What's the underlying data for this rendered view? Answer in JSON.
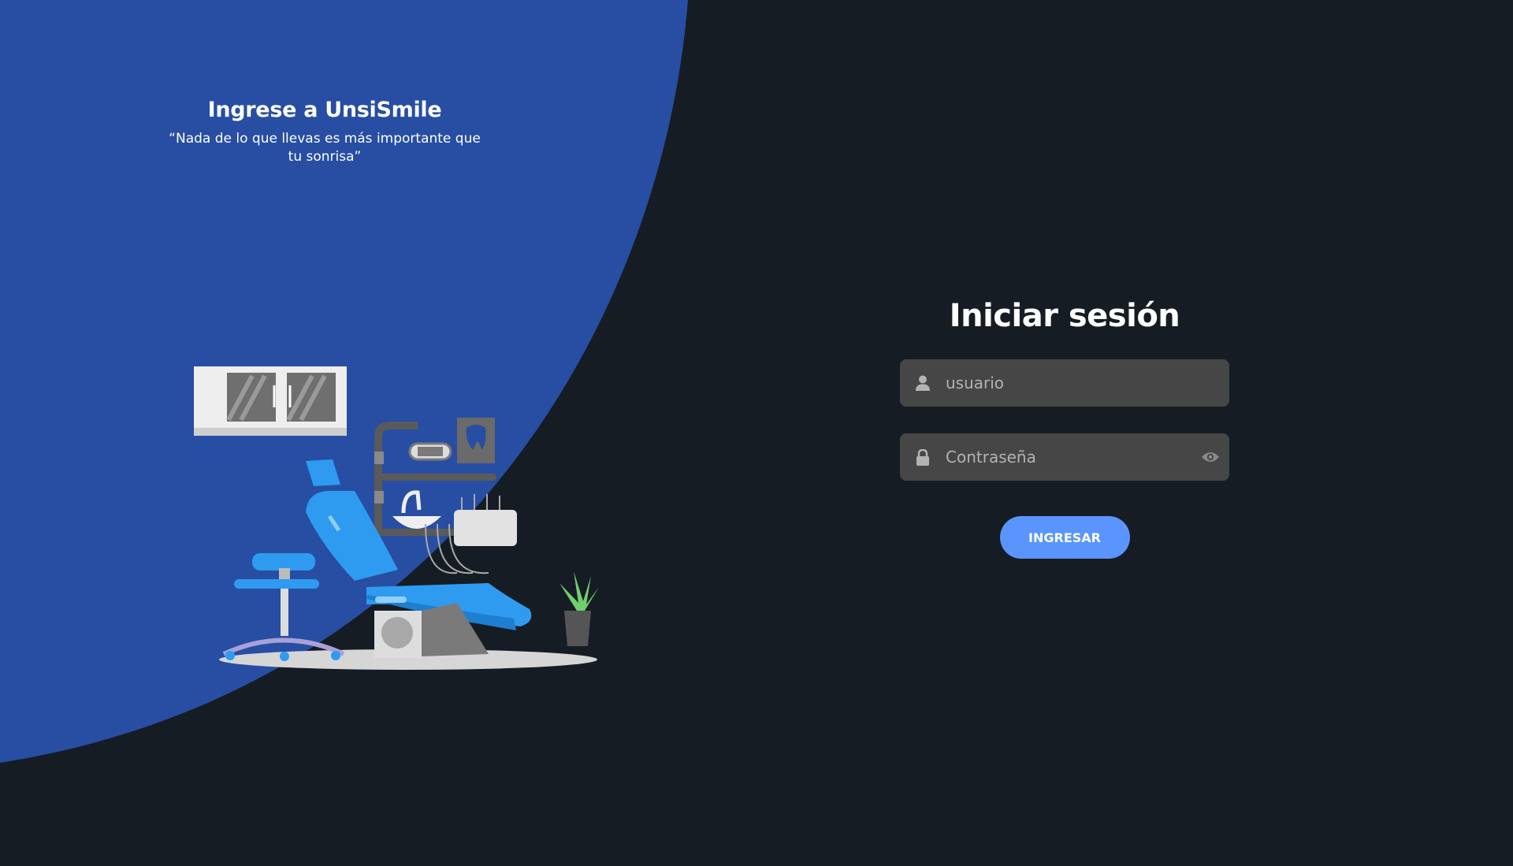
{
  "colors": {
    "background": "#161c24",
    "accent_panel": "#274ea2",
    "input_bg": "#464646",
    "button": "#5995fd",
    "text": "#ffffff"
  },
  "intro": {
    "title": "Ingrese a UnsiSmile",
    "quote": "“Nada de lo que llevas es más importante que tu sonrisa”"
  },
  "login": {
    "title": "Iniciar sesión",
    "username": {
      "value": "",
      "placeholder": "usuario",
      "icon": "user-icon"
    },
    "password": {
      "value": "",
      "placeholder": "Contraseña",
      "icon": "lock-icon",
      "toggle_icon": "eye-icon"
    },
    "submit_label": "INGRESAR"
  },
  "illustration": "dental-office-illustration"
}
